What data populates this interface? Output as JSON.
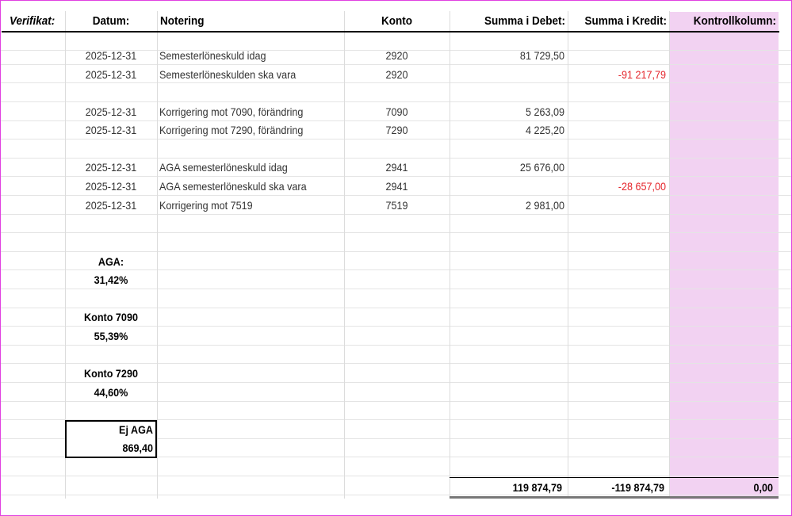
{
  "headers": {
    "verifikat": "Verifikat:",
    "datum": "Datum:",
    "notering": "Notering",
    "konto": "Konto",
    "debet": "Summa i Debet:",
    "kredit": "Summa i Kredit:",
    "kontroll": "Kontrollkolumn:"
  },
  "entries": [
    {
      "datum": "2025-12-31",
      "notering": "Semesterlöneskuld idag",
      "konto": "2920",
      "debet": "81 729,50",
      "kredit": ""
    },
    {
      "datum": "2025-12-31",
      "notering": "Semesterlöneskulden ska vara",
      "konto": "2920",
      "debet": "",
      "kredit": "-91 217,79"
    },
    {
      "datum": "2025-12-31",
      "notering": "Korrigering mot 7090, förändring",
      "konto": "7090",
      "debet": "5 263,09",
      "kredit": ""
    },
    {
      "datum": "2025-12-31",
      "notering": "Korrigering mot 7290, förändring",
      "konto": "7290",
      "debet": "4 225,20",
      "kredit": ""
    },
    {
      "datum": "2025-12-31",
      "notering": "AGA semesterlöneskuld idag",
      "konto": "2941",
      "debet": "25 676,00",
      "kredit": ""
    },
    {
      "datum": "2025-12-31",
      "notering": "AGA semesterlöneskuld ska vara",
      "konto": "2941",
      "debet": "",
      "kredit": "-28 657,00"
    },
    {
      "datum": "2025-12-31",
      "notering": "Korrigering mot 7519",
      "konto": "7519",
      "debet": "2 981,00",
      "kredit": ""
    }
  ],
  "params": {
    "aga_label": "AGA:",
    "aga_value": "31,42%",
    "konto7090_label": "Konto 7090",
    "konto7090_value": "55,39%",
    "konto7290_label": "Konto 7290",
    "konto7290_value": "44,60%",
    "ej_aga_label": "Ej AGA",
    "ej_aga_value": "869,40"
  },
  "totals": {
    "debet": "119 874,79",
    "kredit": "-119 874,79",
    "kontroll": "0,00"
  },
  "colors": {
    "kontroll_column": "#f2d2f2",
    "negative": "#e5262c",
    "frame": "#e040e0"
  }
}
